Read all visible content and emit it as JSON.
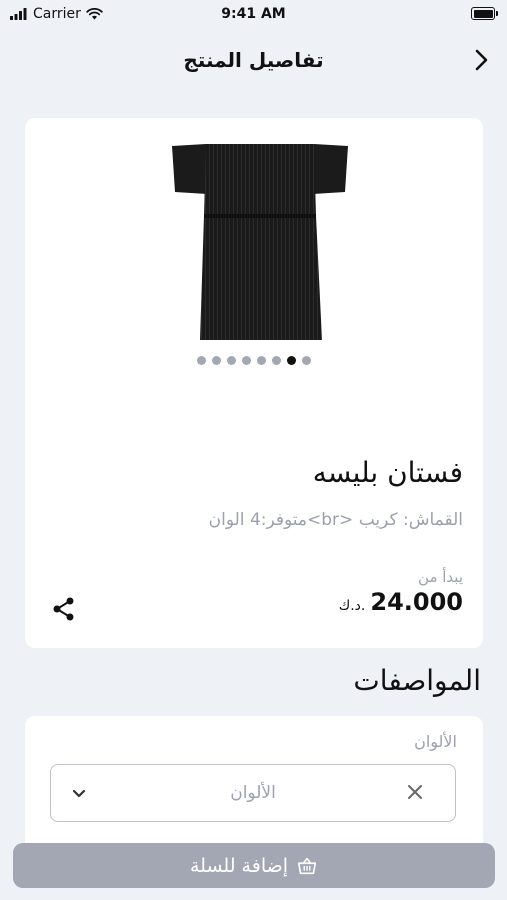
{
  "status_bar": {
    "carrier": "Carrier",
    "time": "9:41 AM"
  },
  "header": {
    "title": "تفاصيل المنتج"
  },
  "product": {
    "title": "فستان بليسه",
    "description": "القماش: كريب <br>متوفر:4 الوان",
    "price_label": "يبدأ من",
    "price": "24.000",
    "currency": "د.ك.",
    "image_count": 8,
    "active_image_index": 6
  },
  "specs": {
    "heading": "المواصفات",
    "colors_label": "الألوان",
    "colors_placeholder": "الألوان"
  },
  "cart": {
    "add_label": "إضافة للسلة"
  },
  "colors": {
    "background": "#eef2f7",
    "card": "#ffffff",
    "muted_text": "#9ca1ab",
    "button_disabled": "#a3a7b4",
    "dot_inactive": "#a3a7b4",
    "dot_active": "#111111"
  },
  "icons": {
    "signal": "cellular-signal-icon",
    "wifi": "wifi-icon",
    "battery": "battery-icon",
    "back": "chevron-right-icon",
    "share": "share-icon",
    "clear": "close-icon",
    "dropdown": "chevron-down-icon",
    "basket": "basket-icon"
  }
}
